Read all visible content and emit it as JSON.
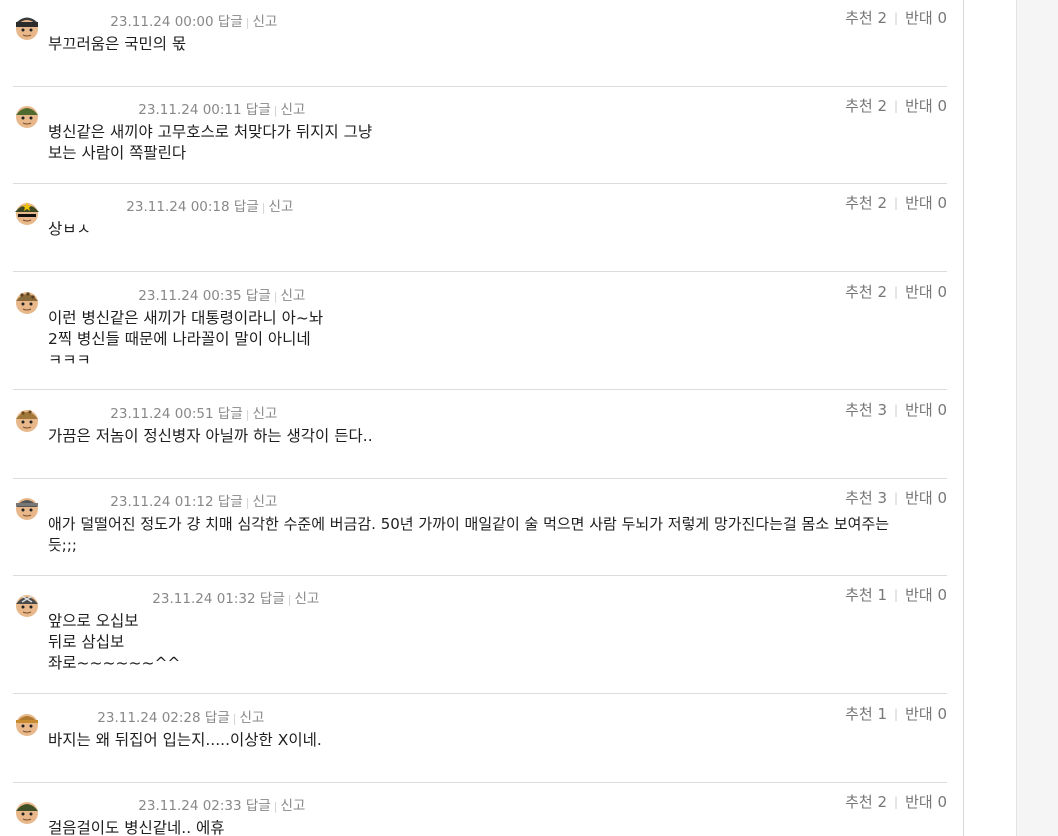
{
  "comments": [
    {
      "time": "23.11.24 00:00",
      "reply": "답글",
      "report": "신고",
      "up_label": "추천",
      "up": "2",
      "down_label": "반대",
      "down": "0",
      "lines": [
        "부끄러움은 국민의 몫"
      ]
    },
    {
      "time": "23.11.24 00:11",
      "reply": "답글",
      "report": "신고",
      "up_label": "추천",
      "up": "2",
      "down_label": "반대",
      "down": "0",
      "lines": [
        "병신같은 새끼야 고무호스로 처맞다가 뒤지지 그냥",
        "보는 사람이 쪽팔린다"
      ]
    },
    {
      "time": "23.11.24 00:18",
      "reply": "답글",
      "report": "신고",
      "up_label": "추천",
      "up": "2",
      "down_label": "반대",
      "down": "0",
      "lines": [
        "상ㅂㅅ"
      ]
    },
    {
      "time": "23.11.24 00:35",
      "reply": "답글",
      "report": "신고",
      "up_label": "추천",
      "up": "2",
      "down_label": "반대",
      "down": "0",
      "lines": [
        "이런 병신같은 새끼가 대통령이라니 아~놔",
        "2찍 병신들 때문에 나라꼴이 말이 아니네",
        "ㅋㅋㅋ"
      ]
    },
    {
      "time": "23.11.24 00:51",
      "reply": "답글",
      "report": "신고",
      "up_label": "추천",
      "up": "3",
      "down_label": "반대",
      "down": "0",
      "lines": [
        "가끔은 저놈이 정신병자 아닐까 하는 생각이 든다.."
      ]
    },
    {
      "time": "23.11.24 01:12",
      "reply": "답글",
      "report": "신고",
      "up_label": "추천",
      "up": "3",
      "down_label": "반대",
      "down": "0",
      "lines": [
        "애가 덜떨어진 정도가 걍 치매 심각한 수준에 버금감. 50년 가까이 매일같이 술 먹으면 사람 두뇌가 저렇게 망가진다는걸 몸소 보여주는 듯;;;"
      ]
    },
    {
      "time": "23.11.24 01:32",
      "reply": "답글",
      "report": "신고",
      "up_label": "추천",
      "up": "1",
      "down_label": "반대",
      "down": "0",
      "lines": [
        "앞으로 오십보",
        "뒤로 삼십보",
        "좌로~~~~~~^^"
      ]
    },
    {
      "time": "23.11.24 02:28",
      "reply": "답글",
      "report": "신고",
      "up_label": "추천",
      "up": "1",
      "down_label": "반대",
      "down": "0",
      "lines": [
        "바지는 왜 뒤집어 입는지.....이상한 X이네."
      ]
    },
    {
      "time": "23.11.24 02:33",
      "reply": "답글",
      "report": "신고",
      "up_label": "추천",
      "up": "2",
      "down_label": "반대",
      "down": "0",
      "lines": [
        "걸음걸이도 병신같네.. 에휴"
      ]
    }
  ]
}
